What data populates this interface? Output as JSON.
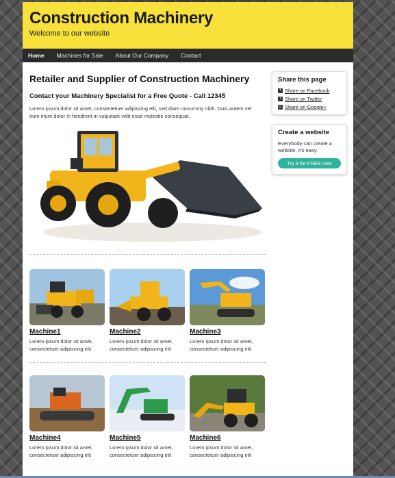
{
  "header": {
    "title": "Construction Machinery",
    "tagline": "Welcome to our website"
  },
  "nav": {
    "items": [
      {
        "label": "Home",
        "active": true
      },
      {
        "label": "Machines for Sale"
      },
      {
        "label": "About Our Company"
      },
      {
        "label": "Contact"
      }
    ]
  },
  "main": {
    "heading": "Retailer and Supplier of Construction Machinery",
    "subheading": "Contact your Machinery Specialist for a Free Quote - Call 12345",
    "intro": "Lorem ipsum dolor sit amet, consectetuer adipiscing elit, sed diam nonummy nibh. Duis autem vel eum iriure dolor in hendrerit in vulputate velit esse molestie consequat.",
    "machines": [
      {
        "title": "Machine1",
        "text": "Lorem ipsum dolor sit amet, consectetuer adipiscing elit"
      },
      {
        "title": "Machine2",
        "text": "Lorem ipsum dolor sit amet, consectetuer adipiscing elit"
      },
      {
        "title": "Machine3",
        "text": "Lorem ipsum dolor sit amet, consectetuer adipiscing elit"
      },
      {
        "title": "Machine4",
        "text": "Lorem ipsum dolor sit amet, consectetuer adipiscing elit"
      },
      {
        "title": "Machine5",
        "text": "Lorem ipsum dolor sit amet, consectetuer adipiscing elit"
      },
      {
        "title": "Machine6",
        "text": "Lorem ipsum dolor sit amet, consectetuer adipiscing elit"
      }
    ]
  },
  "sidebar": {
    "share": {
      "title": "Share this page",
      "links": [
        {
          "label": "Share on Facebook",
          "icon": "facebook-icon"
        },
        {
          "label": "Share on Twitter",
          "icon": "twitter-icon"
        },
        {
          "label": "Share on Google+",
          "icon": "googleplus-icon"
        }
      ]
    },
    "create": {
      "title": "Create a website",
      "text": "Everybody can create a website, it's easy.",
      "button": "Try it for FREE now"
    }
  },
  "colors": {
    "header": "#f7e13a",
    "nav": "#2a2a2a",
    "cta": "#2fb39a"
  }
}
